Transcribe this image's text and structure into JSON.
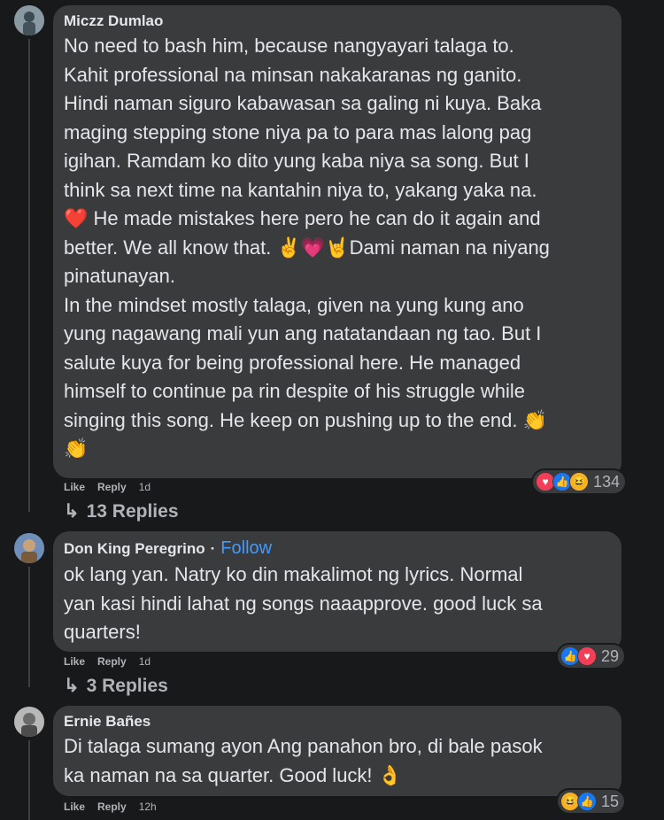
{
  "comments": [
    {
      "author": "Miczz Dumlao",
      "lines": [
        "No need to bash him, because nangyayari talaga to.",
        "Kahit professional na minsan nakakaranas ng ganito.",
        "Hindi naman siguro kabawasan sa galing ni kuya. Baka",
        "maging stepping stone niya pa to para mas lalong pag",
        "igihan. Ramdam ko dito yung kaba niya sa song. But I",
        "think sa next time na kantahin niya to, yakang yaka na.",
        "❤️ He made mistakes here pero he can do it again and",
        "better. We all know that. ✌️💗🤘Dami naman na niyang",
        "pinatunayan.",
        "In the mindset mostly talaga, given na yung kung ano",
        "yung nagawang mali yun ang natatandaan ng tao. But I",
        "salute kuya for being professional here. He managed",
        "himself to continue pa rin despite of his struggle while",
        "singing this song. He keep on pushing up to the end. 👏",
        "👏"
      ],
      "like": "Like",
      "reply": "Reply",
      "time": "1d",
      "reaction_count": "134",
      "replies": "13 Replies"
    },
    {
      "author": "Don King Peregrino",
      "follow": "Follow",
      "separator": "·",
      "lines": [
        "ok lang yan. Natry ko din makalimot ng lyrics. Normal",
        "yan kasi hindi lahat ng songs naaapprove. good luck sa",
        "quarters!"
      ],
      "like": "Like",
      "reply": "Reply",
      "time": "1d",
      "reaction_count": "29",
      "replies": "3 Replies"
    },
    {
      "author": "Ernie Bañes",
      "lines": [
        "Di talaga sumang ayon Ang panahon bro, di bale pasok",
        "ka naman na sa quarter. Good luck! 👌"
      ],
      "like": "Like",
      "reply": "Reply",
      "time": "12h",
      "reaction_count": "15"
    }
  ],
  "icons": {
    "reply_arrow": "↳",
    "love": "♥",
    "like": "👍",
    "haha": "😆"
  }
}
